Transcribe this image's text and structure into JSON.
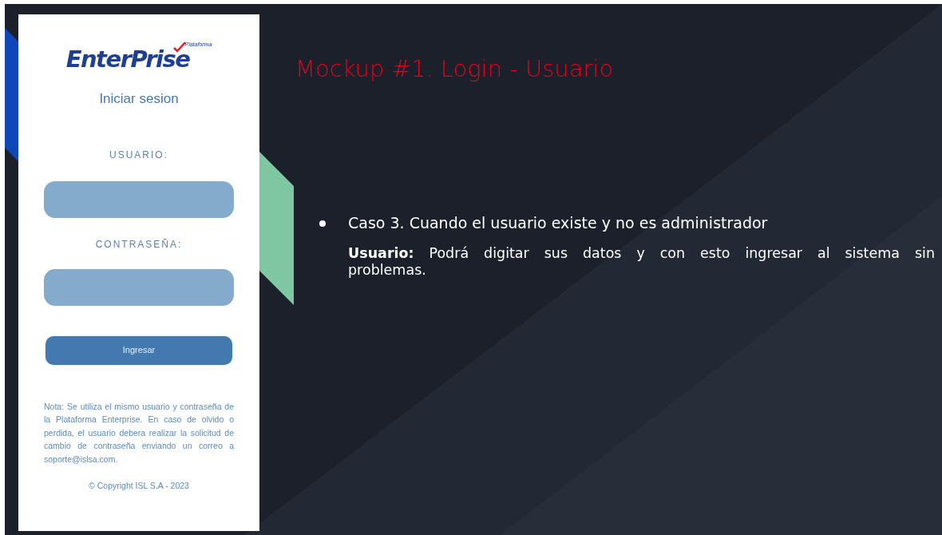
{
  "slide": {
    "title": "Mockup #1. Login - Usuario",
    "bullets": [
      {
        "heading": "Caso 3.  Cuando el usuario existe y no es administrador",
        "body": "**Usuario:** Podrá digitar sus datos y con esto ingresar al sistema sin problemas."
      }
    ]
  },
  "mockup": {
    "logo": {
      "text": "EnterPrise",
      "tagline": "Plataforma"
    },
    "heading": "Iniciar sesion",
    "fields": [
      {
        "label": "USUARIO:"
      },
      {
        "label": "CONTRASEÑA:"
      }
    ],
    "button": "Ingresar",
    "note": "Nota: Se utiliza el mismo usuario y contraseña de la Plataforma Enterprise.  En caso de olvido o perdida, el usuario debera realizar la solicitud de cambio de contraseña enviando un correo a soporte@islsa.com.",
    "copyright": "© Copyright ISL S.A - 2023"
  }
}
